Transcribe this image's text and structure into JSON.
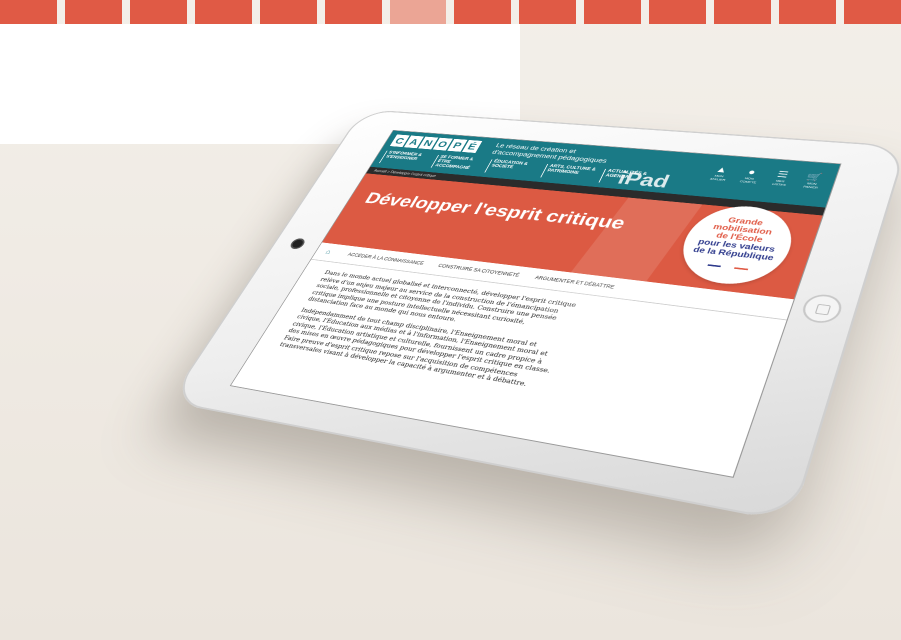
{
  "top_strip": {
    "letters": [
      "",
      "",
      "",
      "",
      "",
      "",
      "",
      "",
      "",
      "",
      "",
      "",
      "",
      ""
    ]
  },
  "site": {
    "logo": [
      "C",
      "A",
      "N",
      "O",
      "P",
      "É"
    ],
    "tagline": "Le réseau de création et d'accompagnement pédagogiques",
    "nav": [
      "S'INFORMER & S'ENSEIGNER",
      "SE FORMER & ÊTRE ACCOMPAGNÉ",
      "ÉDUCATION & SOCIÉTÉ",
      "ARTS, CULTURE & PATRIMOINE",
      "ACTUALITÉS & AGENDA"
    ],
    "icons": [
      {
        "name": "mon-atelier-icon",
        "glyph": "▲",
        "label": "MON ATELIER"
      },
      {
        "name": "mon-compte-icon",
        "glyph": "●",
        "label": "MON COMPTE"
      },
      {
        "name": "mes-listes-icon",
        "glyph": "☰",
        "label": "MES LISTES"
      },
      {
        "name": "mon-panier-icon",
        "glyph": "🛒",
        "label": "MON PANIER"
      }
    ],
    "device_mark": "iPad",
    "breadcrumb": "Accueil > Développer l'esprit critique"
  },
  "hero": {
    "title": "Développer l'esprit critique"
  },
  "badge": {
    "line1": "Grande",
    "line2": "mobilisation",
    "line3": "de l'École",
    "line4": "pour les valeurs",
    "line5": "de la République"
  },
  "tabs": [
    "ACCÉDER À LA CONNAISSANCE",
    "CONSTRUIRE SA CITOYENNETÉ",
    "ARGUMENTER ET DÉBATTRE"
  ],
  "content": {
    "p1": "Dans le monde actuel globalisé et interconnecté, développer l'esprit critique relève d'un enjeu majeur au service de la construction de l'émancipation sociale, professionnelle et citoyenne de l'individu. Construire une pensée critique implique une posture intellectuelle nécessitant curiosité, distanciation face au monde qui nous entoure.",
    "p2": "Indépendamment de tout champ disciplinaire, l'Enseignement moral et civique, l'Éducation aux médias et à l'information, l'Enseignement moral et civique, l'Éducation artistique et culturelle, fournissent un cadre propice à des mises en œuvre pédagogiques pour développer l'esprit critique en classe. Faire preuve d'esprit critique repose sur l'acquisition de compétences transversales visant à développer la capacité à argumenter et à débattre."
  },
  "colors": {
    "brand_teal": "#1a7a86",
    "hero_red": "#dc5a43",
    "badge_blue": "#2e3a8c"
  }
}
